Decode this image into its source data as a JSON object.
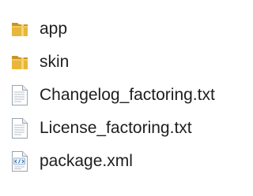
{
  "explorer": {
    "items": [
      {
        "name": "app",
        "icon": "folder-icon"
      },
      {
        "name": "skin",
        "icon": "folder-icon"
      },
      {
        "name": "Changelog_factoring.txt",
        "icon": "text-document-icon"
      },
      {
        "name": "License_factoring.txt",
        "icon": "text-document-icon"
      },
      {
        "name": "package.xml",
        "icon": "xml-document-icon"
      }
    ]
  },
  "colors": {
    "folder_front": "#e8b63a",
    "folder_back": "#c9932a",
    "document_border": "#9aa3ad",
    "text": "#1e1e1e"
  }
}
